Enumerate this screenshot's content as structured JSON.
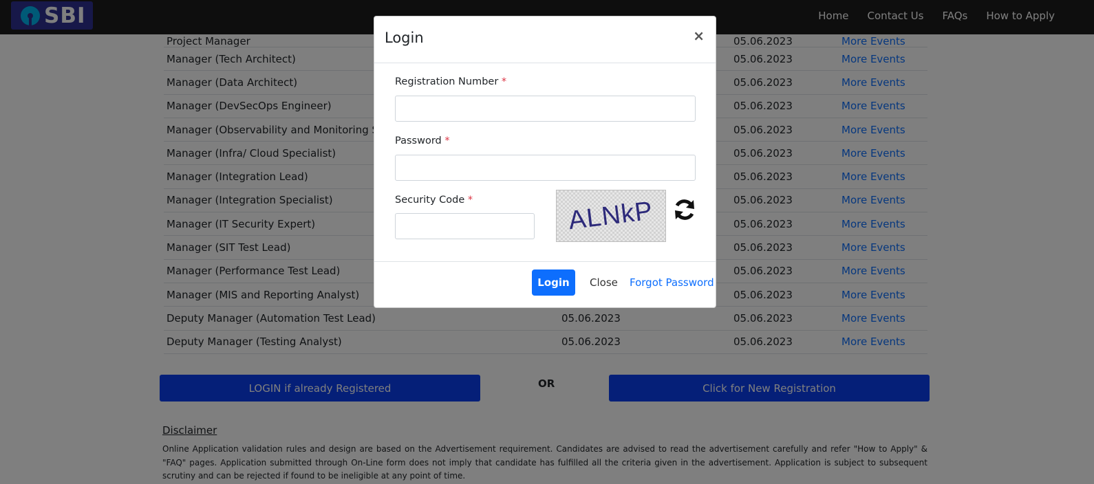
{
  "header": {
    "logo_text": "SBI",
    "nav": [
      "Home",
      "Contact Us",
      "FAQs",
      "How to Apply"
    ]
  },
  "table": {
    "rows": [
      {
        "post": "Project Manager",
        "date1": "",
        "date2": "05.06.2023",
        "link": "More Events"
      },
      {
        "post": "Manager (Tech Architect)",
        "date1": "",
        "date2": "05.06.2023",
        "link": "More Events"
      },
      {
        "post": "Manager (Data Architect)",
        "date1": "",
        "date2": "05.06.2023",
        "link": "More Events"
      },
      {
        "post": "Manager (DevSecOps Engineer)",
        "date1": "",
        "date2": "05.06.2023",
        "link": "More Events"
      },
      {
        "post": "Manager (Observability and Monitoring Speci",
        "date1": "",
        "date2": "05.06.2023",
        "link": "More Events"
      },
      {
        "post": "Manager (Infra/ Cloud Specialist)",
        "date1": "",
        "date2": "05.06.2023",
        "link": "More Events"
      },
      {
        "post": "Manager (Integration Lead)",
        "date1": "",
        "date2": "05.06.2023",
        "link": "More Events"
      },
      {
        "post": "Manager (Integration Specialist)",
        "date1": "",
        "date2": "05.06.2023",
        "link": "More Events"
      },
      {
        "post": "Manager (IT Security Expert)",
        "date1": "",
        "date2": "05.06.2023",
        "link": "More Events"
      },
      {
        "post": "Manager (SIT Test Lead)",
        "date1": "",
        "date2": "05.06.2023",
        "link": "More Events"
      },
      {
        "post": "Manager (Performance Test Lead)",
        "date1": "",
        "date2": "05.06.2023",
        "link": "More Events"
      },
      {
        "post": "Manager (MIS and Reporting Analyst)",
        "date1": "",
        "date2": "05.06.2023",
        "link": "More Events"
      },
      {
        "post": "Deputy Manager (Automation Test Lead)",
        "date1": "05.06.2023",
        "date2": "05.06.2023",
        "link": "More Events"
      },
      {
        "post": "Deputy Manager (Testing Analyst)",
        "date1": "05.06.2023",
        "date2": "05.06.2023",
        "link": "More Events"
      }
    ]
  },
  "actions": {
    "login_registered": "LOGIN if already Registered",
    "or": "OR",
    "new_registration": "Click for New Registration"
  },
  "disclaimer": {
    "title": "Disclaimer",
    "text": "Online Application validation rules and design are based on the Advertisement requirement. Candidates are advised to read the advertisement carefully and refer \"How to Apply\" & \"FAQ\" pages. Application submitted through On-Line form does not imply that candidate has fulfilled all the criteria given in the advertisement. Application is subject to subsequent scrutiny and can be rejected if found to be ineligible at any point of time."
  },
  "modal": {
    "title": "Login",
    "close_symbol": "×",
    "reg_label": "Registration Number",
    "password_label": "Password",
    "security_label": "Security Code",
    "required_mark": "*",
    "captcha_text": "ALNkP",
    "login_button": "Login",
    "close_button": "Close",
    "forgot_link": "Forgot Password"
  },
  "colors": {
    "primary": "#0d6efd",
    "action_blue": "#0b3ef0",
    "navbar": "#1c1c1c",
    "logo_bg": "#2e3192"
  }
}
